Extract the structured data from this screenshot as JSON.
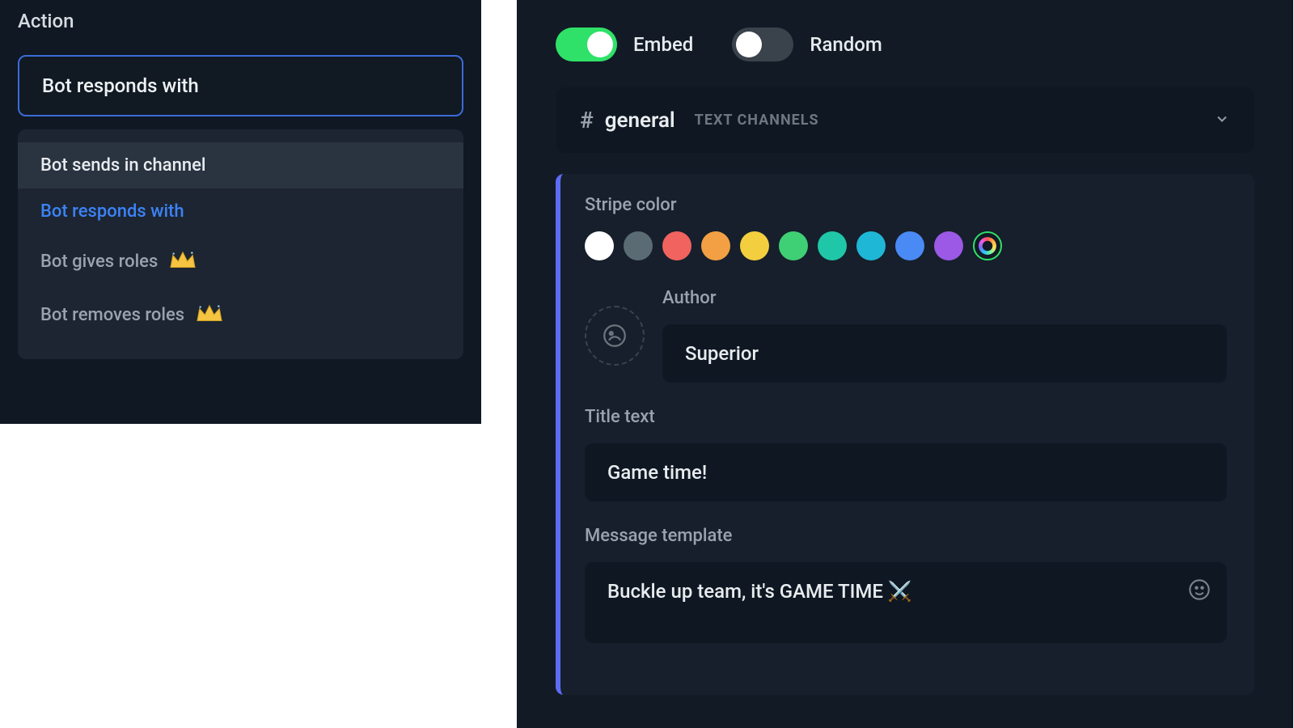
{
  "left": {
    "section_label": "Action",
    "selected_value": "Bot responds with",
    "options": [
      {
        "label": "Bot sends in channel",
        "highlight": true,
        "selected": false,
        "premium": false
      },
      {
        "label": "Bot responds with",
        "highlight": false,
        "selected": true,
        "premium": false
      },
      {
        "label": "Bot gives roles",
        "highlight": false,
        "selected": false,
        "premium": true
      },
      {
        "label": "Bot removes roles",
        "highlight": false,
        "selected": false,
        "premium": true
      }
    ]
  },
  "right": {
    "toggles": {
      "embed": {
        "label": "Embed",
        "on": true
      },
      "random": {
        "label": "Random",
        "on": false
      }
    },
    "channel": {
      "name": "general",
      "hint": "TEXT CHANNELS"
    },
    "stripe": {
      "label": "Stripe color",
      "colors": [
        "#ffffff",
        "#5b6b73",
        "#f1635f",
        "#f2a043",
        "#f3cf3f",
        "#3fcf75",
        "#1fc7a8",
        "#1fb7d6",
        "#4a8af4",
        "#9b59e6"
      ]
    },
    "author": {
      "label": "Author",
      "value": "Superior"
    },
    "title": {
      "label": "Title text",
      "value": "Game time!"
    },
    "message": {
      "label": "Message template",
      "value": "Buckle up team, it's GAME TIME ⚔️"
    }
  }
}
